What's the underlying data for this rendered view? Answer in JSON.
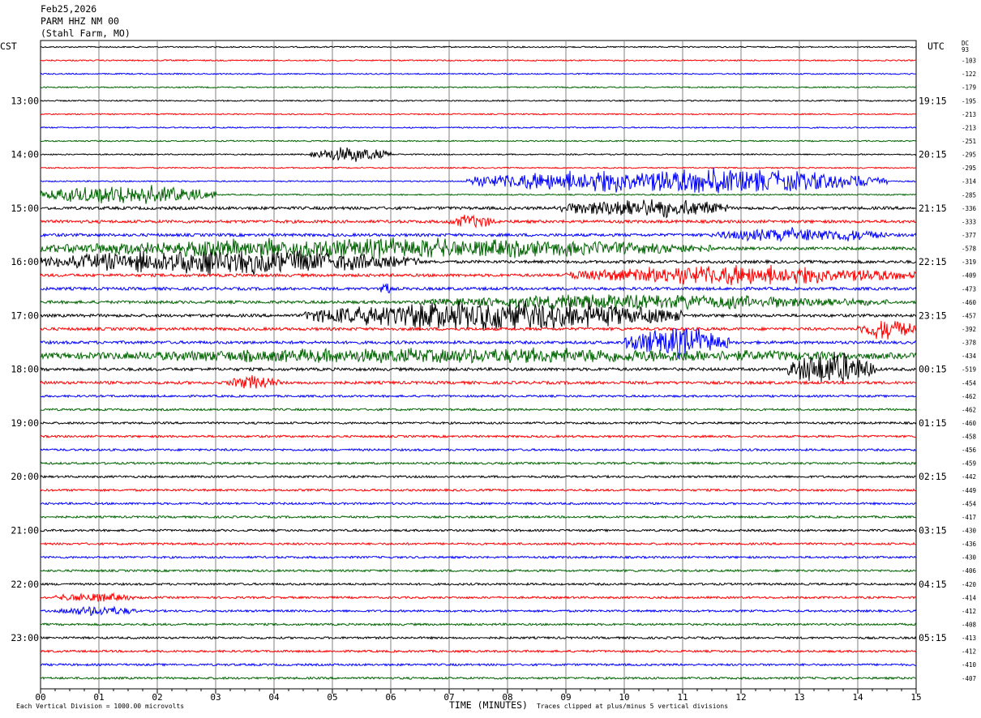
{
  "header": {
    "date": "Feb25,2026",
    "station": "PARM HHZ NM 00",
    "location": "(Stahl Farm, MO)"
  },
  "left_timezone": "CST",
  "right_timezone": "UTC",
  "dc_label": "DC",
  "footer": {
    "left_note": "Each Vertical Division = 1000.00 microvolts",
    "xlabel": "TIME (MINUTES)",
    "right_note": "Traces clipped at plus/minus 5 vertical divisions"
  },
  "colors": {
    "black": "#000000",
    "red": "#ff0000",
    "blue": "#0000ff",
    "green": "#006400",
    "grid": "#808080"
  },
  "chart_data": {
    "type": "line",
    "title": "PARM HHZ NM 00",
    "xlabel": "TIME (MINUTES)",
    "x_ticks": [
      "00",
      "01",
      "02",
      "03",
      "04",
      "05",
      "06",
      "07",
      "08",
      "09",
      "10",
      "11",
      "12",
      "13",
      "14",
      "15"
    ],
    "xlim": [
      0,
      15
    ],
    "trace_color_cycle": [
      "black",
      "red",
      "blue",
      "green"
    ],
    "left_hour_labels": [
      "13:00",
      "14:00",
      "15:00",
      "16:00",
      "17:00",
      "18:00",
      "19:00",
      "20:00",
      "21:00",
      "22:00",
      "23:00"
    ],
    "right_hour_labels": [
      "19:15",
      "20:15",
      "21:15",
      "22:15",
      "23:15",
      "00:15",
      "01:15",
      "02:15",
      "03:15",
      "04:15",
      "05:15"
    ],
    "dc_offsets": [
      "93",
      "-103",
      "-122",
      "-179",
      "-195",
      "-213",
      "-213",
      "-251",
      "-295",
      "-295",
      "-314",
      "-285",
      "-336",
      "-333",
      "-377",
      "-578",
      "-319",
      "-409",
      "-473",
      "-460",
      "-457",
      "-392",
      "-378",
      "-434",
      "-519",
      "-454",
      "-462",
      "-462",
      "-460",
      "-458",
      "-456",
      "-459",
      "-442",
      "-449",
      "-454",
      "-417",
      "-430",
      "-436",
      "-430",
      "-406",
      "-420",
      "-414",
      "-412",
      "-408",
      "-413",
      "-412",
      "-410",
      "-407"
    ],
    "trace_count": 48,
    "events": [
      {
        "trace": 8,
        "start": 4.6,
        "end": 6.0,
        "level": 3
      },
      {
        "trace": 10,
        "start": 7.3,
        "end": 14.5,
        "level": 5
      },
      {
        "trace": 11,
        "start": 0,
        "end": 3,
        "level": 4
      },
      {
        "trace": 12,
        "start": 8.8,
        "end": 11.8,
        "level": 4
      },
      {
        "trace": 13,
        "start": 7.0,
        "end": 7.8,
        "level": 3
      },
      {
        "trace": 14,
        "start": 11.5,
        "end": 14.5,
        "level": 3
      },
      {
        "trace": 15,
        "start": 0,
        "end": 11.5,
        "level": 4
      },
      {
        "trace": 16,
        "start": 0,
        "end": 6.5,
        "level": 5
      },
      {
        "trace": 17,
        "start": 9.0,
        "end": 15,
        "level": 4
      },
      {
        "trace": 18,
        "start": 5.8,
        "end": 6.0,
        "level": 3
      },
      {
        "trace": 19,
        "start": 6.5,
        "end": 14.5,
        "level": 3
      },
      {
        "trace": 20,
        "start": 4.5,
        "end": 11,
        "level": 6
      },
      {
        "trace": 21,
        "start": 14.0,
        "end": 15,
        "level": 4
      },
      {
        "trace": 22,
        "start": 10,
        "end": 11.8,
        "level": 6
      },
      {
        "trace": 23,
        "start": 0,
        "end": 15,
        "level": 3
      },
      {
        "trace": 24,
        "start": 12.8,
        "end": 14.3,
        "level": 7
      },
      {
        "trace": 25,
        "start": 3.2,
        "end": 4.1,
        "level": 3
      },
      {
        "trace": 41,
        "start": 0.2,
        "end": 1.6,
        "level": 2
      },
      {
        "trace": 42,
        "start": 0.3,
        "end": 1.7,
        "level": 2
      }
    ]
  }
}
